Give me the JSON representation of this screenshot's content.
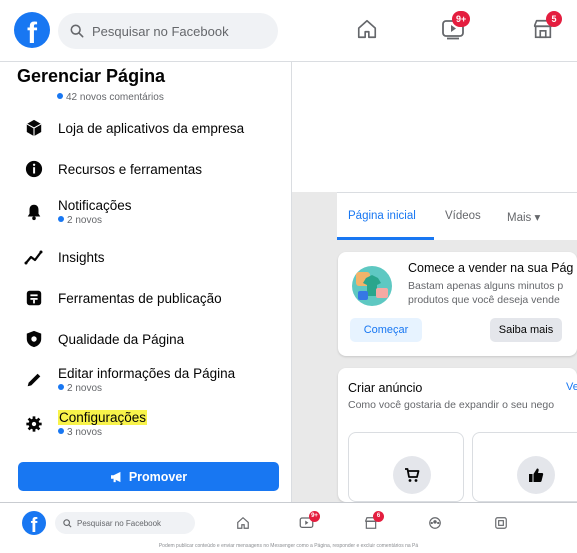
{
  "topbar": {
    "logo_letter": "f",
    "search_placeholder": "Pesquisar no Facebook",
    "watch_badge": "9+",
    "marketplace_badge": "5"
  },
  "panel": {
    "title": "Gerenciar Página",
    "top_sub": "42 novos comentários",
    "items": [
      {
        "label": "Loja de aplicativos da empresa",
        "icon": "cube-icon"
      },
      {
        "label": "Recursos e ferramentas",
        "icon": "info-icon"
      },
      {
        "label": "Notificações",
        "sub": "2 novos",
        "icon": "bell-icon"
      },
      {
        "label": "Insights",
        "icon": "insights-icon"
      },
      {
        "label": "Ferramentas de publicação",
        "icon": "publishing-tools-icon"
      },
      {
        "label": "Qualidade da Página",
        "icon": "shield-icon"
      },
      {
        "label": "Editar informações da Página",
        "sub": "2 novos",
        "icon": "pencil-icon"
      },
      {
        "label": "Configurações",
        "sub": "3 novos",
        "icon": "gear-icon",
        "highlighted": true
      }
    ],
    "promote_label": "Promover"
  },
  "tabs": {
    "home": "Página inicial",
    "videos": "Vídeos",
    "more": "Mais ▾"
  },
  "sell_card": {
    "title": "Comece a vender na sua Pág",
    "body_line1": "Bastam apenas alguns minutos p",
    "body_line2": "produtos que você deseja vende",
    "start_label": "Começar",
    "learn_label": "Saiba mais"
  },
  "ad_card": {
    "title": "Criar anúncio",
    "link": "Ve",
    "body": "Como você gostaria de expandir o seu nego"
  },
  "bottom": {
    "search_placeholder": "Pesquisar no Facebook",
    "watch_badge": "9+",
    "marketplace_badge": "6",
    "footer_text": "Podem publicar conteúdo e enviar mensagens no Messenger como a Página, responder e excluir comentários na Pá"
  },
  "colors": {
    "brand": "#1877f2",
    "badge": "#e41e3f",
    "highlight": "#f8f34a"
  }
}
